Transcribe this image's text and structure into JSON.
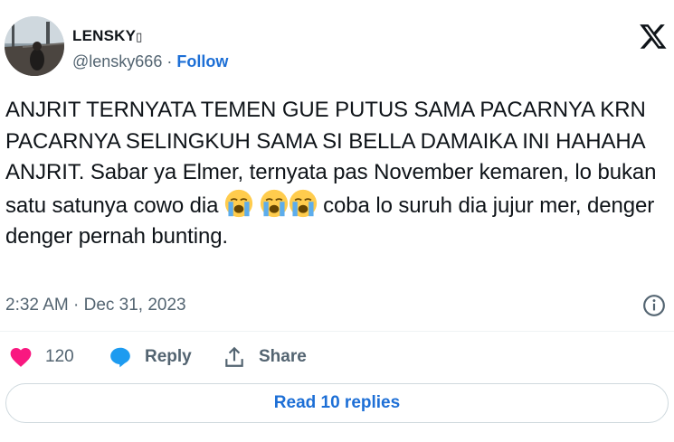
{
  "author": {
    "display_name": "LENSKY",
    "name_badge": "▯",
    "handle": "@lensky666",
    "separator": "·",
    "follow_label": "Follow"
  },
  "tweet": {
    "text_part1": "ANJRIT TERNYATA TEMEN GUE PUTUS SAMA PACARNYA KRN PACARNYA SELINGKUH SAMA SI BELLA DAMAIKA INI HAHAHA ANJRIT. Sabar ya Elmer, ternyata pas November kemaren, lo bukan satu satunya cowo dia",
    "text_part2": "coba lo suruh dia jujur mer, denger denger pernah bunting.",
    "emoji": "loudly-crying-face",
    "timestamp": "2:32 AM · Dec 31, 2023"
  },
  "actions": {
    "like_count": "120",
    "reply_label": "Reply",
    "share_label": "Share",
    "read_replies_label": "Read 10 replies"
  },
  "colors": {
    "like": "#f91880",
    "reply": "#1d9bf0",
    "link": "#1d6fd6",
    "muted": "#536471"
  }
}
